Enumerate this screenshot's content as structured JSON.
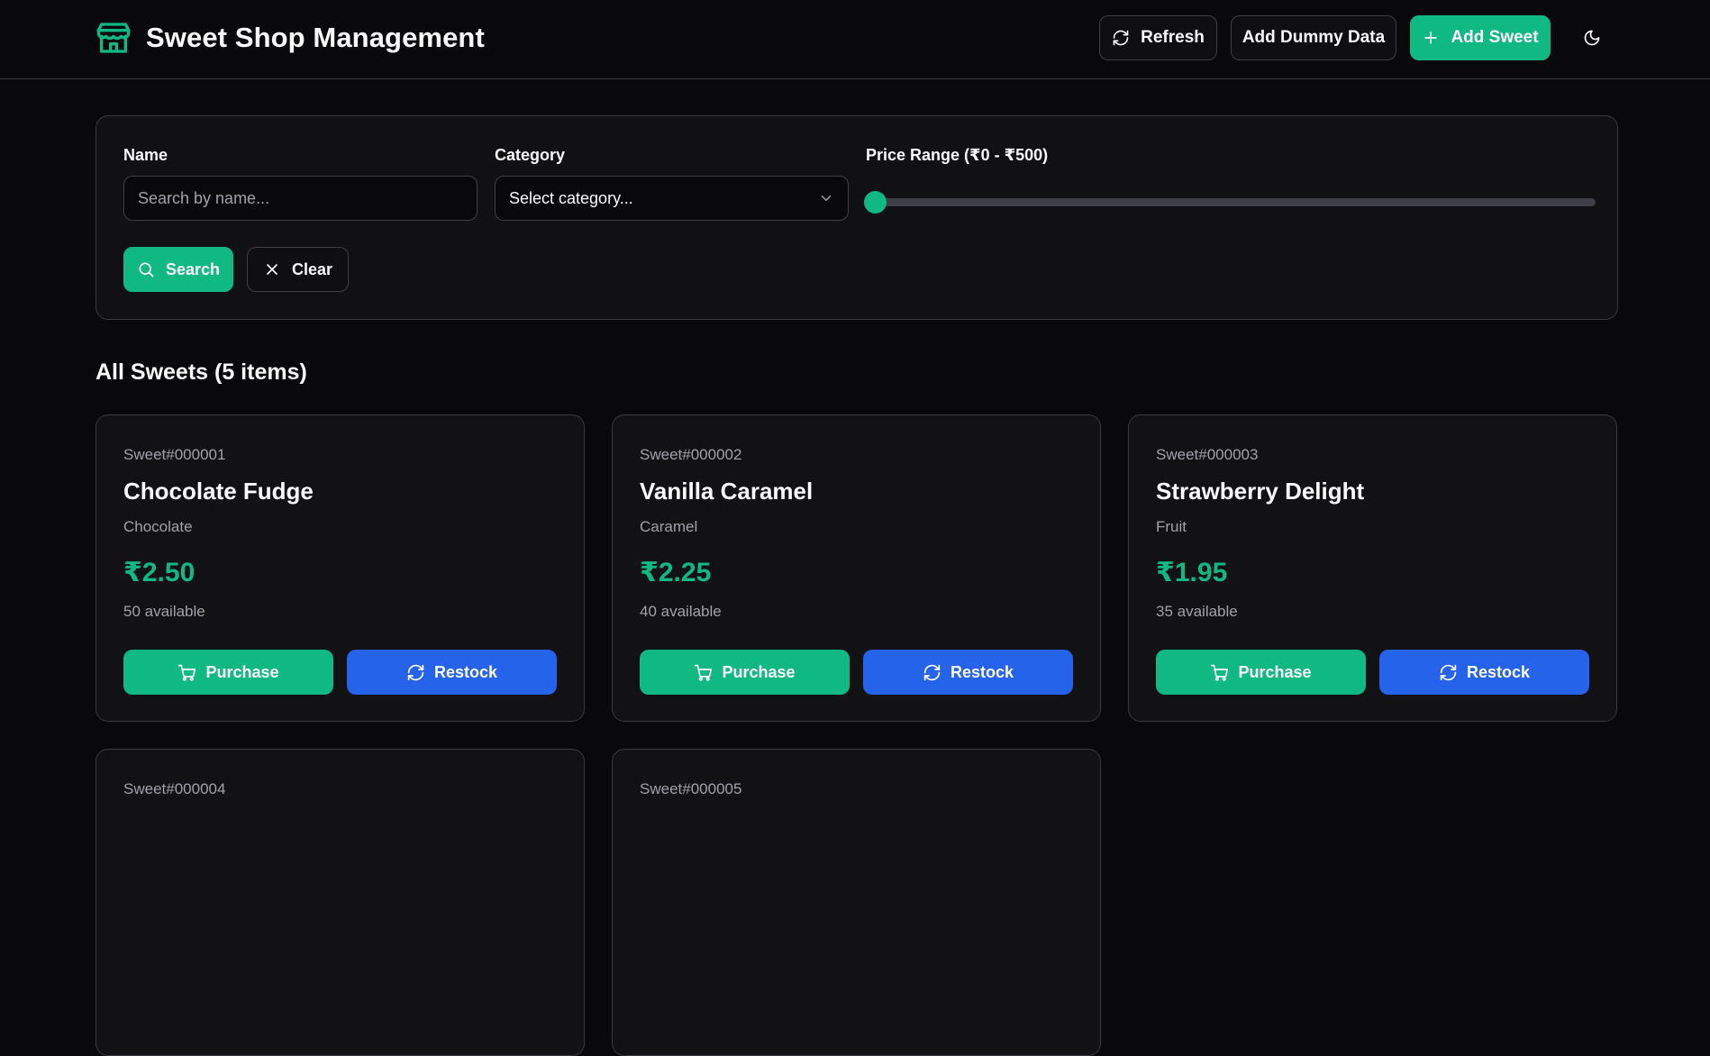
{
  "header": {
    "title": "Sweet Shop Management",
    "refresh_label": "Refresh",
    "dummy_label": "Add Dummy Data",
    "add_label": "Add Sweet"
  },
  "filters": {
    "name_label": "Name",
    "name_placeholder": "Search by name...",
    "category_label": "Category",
    "category_value": "Select category...",
    "price_label": "Price Range (₹0 - ₹500)",
    "price_value": 0,
    "search_label": "Search",
    "clear_label": "Clear"
  },
  "section": {
    "title": "All Sweets (5 items)"
  },
  "sweets": [
    {
      "id": "Sweet#000001",
      "name": "Chocolate Fudge",
      "category": "Chocolate",
      "price": "₹2.50",
      "qty": "50 available",
      "purchase": "Purchase",
      "restock": "Restock"
    },
    {
      "id": "Sweet#000002",
      "name": "Vanilla Caramel",
      "category": "Caramel",
      "price": "₹2.25",
      "qty": "40 available",
      "purchase": "Purchase",
      "restock": "Restock"
    },
    {
      "id": "Sweet#000003",
      "name": "Strawberry Delight",
      "category": "Fruit",
      "price": "₹1.95",
      "qty": "35 available",
      "purchase": "Purchase",
      "restock": "Restock"
    },
    {
      "id": "Sweet#000004"
    },
    {
      "id": "Sweet#000005"
    }
  ],
  "colors": {
    "accent": "#10b981",
    "restock": "#2563eb",
    "background": "#09090b",
    "card": "#121215"
  },
  "icons": [
    "store-icon",
    "refresh-icon",
    "plus-icon",
    "moon-icon",
    "search-icon",
    "close-icon",
    "chevron-down-icon",
    "cart-icon"
  ]
}
